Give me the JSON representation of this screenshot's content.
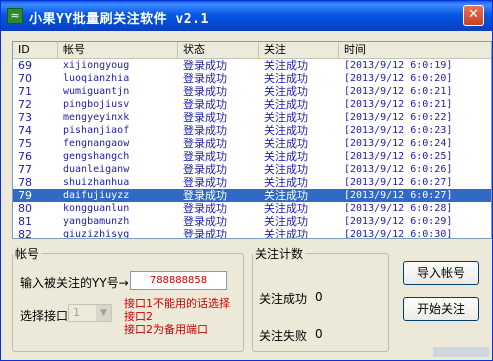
{
  "window": {
    "title": "小果YY批量刷关注软件 v2.1",
    "close_label": "✕"
  },
  "listview": {
    "columns": [
      "ID",
      "帐号",
      "状态",
      "关注",
      "时间"
    ],
    "rows": [
      {
        "id": "69",
        "account": "xijiongyoug",
        "status": "登录成功",
        "follow": "关注成功",
        "time": "[2013/9/12 6:0:19]"
      },
      {
        "id": "70",
        "account": "luoqianzhia",
        "status": "登录成功",
        "follow": "关注成功",
        "time": "[2013/9/12 6:0:20]"
      },
      {
        "id": "71",
        "account": "wumiguantjn",
        "status": "登录成功",
        "follow": "关注成功",
        "time": "[2013/9/12 6:0:21]"
      },
      {
        "id": "72",
        "account": "pingbojiusv",
        "status": "登录成功",
        "follow": "关注成功",
        "time": "[2013/9/12 6:0:21]"
      },
      {
        "id": "73",
        "account": "mengyeyinxk",
        "status": "登录成功",
        "follow": "关注成功",
        "time": "[2013/9/12 6:0:22]"
      },
      {
        "id": "74",
        "account": "pishanjiaof",
        "status": "登录成功",
        "follow": "关注成功",
        "time": "[2013/9/12 6:0:23]"
      },
      {
        "id": "75",
        "account": "fengnangaow",
        "status": "登录成功",
        "follow": "关注成功",
        "time": "[2013/9/12 6:0:24]"
      },
      {
        "id": "76",
        "account": "gengshangch",
        "status": "登录成功",
        "follow": "关注成功",
        "time": "[2013/9/12 6:0:25]"
      },
      {
        "id": "77",
        "account": "duanleiganw",
        "status": "登录成功",
        "follow": "关注成功",
        "time": "[2013/9/12 6:0:26]"
      },
      {
        "id": "78",
        "account": "shuizhanhua",
        "status": "登录成功",
        "follow": "关注成功",
        "time": "[2013/9/12 6:0:27]"
      },
      {
        "id": "79",
        "account": "daifujiuyzz",
        "status": "登录成功",
        "follow": "关注成功",
        "time": "[2013/9/12 6:0:27]"
      },
      {
        "id": "80",
        "account": "kongguanlun",
        "status": "登录成功",
        "follow": "关注成功",
        "time": "[2013/9/12 6:0:28]"
      },
      {
        "id": "81",
        "account": "yangbamunzh",
        "status": "登录成功",
        "follow": "关注成功",
        "time": "[2013/9/12 6:0:29]"
      },
      {
        "id": "82",
        "account": "qiuzizhisyg",
        "status": "登录成功",
        "follow": "关注成功",
        "time": "[2013/9/12 6:0:30]"
      }
    ],
    "selected_index": 10
  },
  "account_group": {
    "legend": "帐号",
    "yy_label": "输入被关注的YY号→",
    "yy_value": "788888858",
    "port_label": "选择接口",
    "port_value": "1",
    "note_lines": [
      "接口1不能用的话选择",
      "接口2",
      "接口2为备用端口"
    ]
  },
  "stats_group": {
    "legend": "关注计数",
    "success_label": "关注成功",
    "success_value": "0",
    "fail_label": "关注失败",
    "fail_value": "0"
  },
  "buttons": {
    "import": "导入帐号",
    "start": "开始关注"
  },
  "colors": {
    "row_text": "#1e1ea8",
    "selected_bg": "#316ac5",
    "note_red": "#cc0000",
    "titlebar": "#0a5fe8"
  }
}
